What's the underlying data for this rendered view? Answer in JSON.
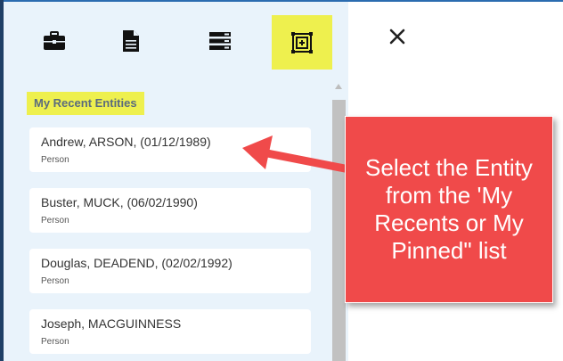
{
  "toolbar": {
    "buttons": [
      {
        "icon": "briefcase-icon",
        "active": false
      },
      {
        "icon": "document-icon",
        "active": false
      },
      {
        "icon": "list-icon",
        "active": false
      },
      {
        "icon": "frame-select-icon",
        "active": true
      }
    ],
    "active_color": "#eef04e"
  },
  "section": {
    "title": "My Recent Entities"
  },
  "entities": [
    {
      "name": "Andrew, ARSON, (01/12/1989)",
      "type": "Person"
    },
    {
      "name": "Buster, MUCK, (06/02/1990)",
      "type": "Person"
    },
    {
      "name": "Douglas, DEADEND, (02/02/1992)",
      "type": "Person"
    },
    {
      "name": "Joseph, MACGUINNESS",
      "type": "Person"
    }
  ],
  "close": {
    "icon": "close-icon"
  },
  "callout": {
    "text": "Select the Entity from the 'My Recents or My Pinned\" list",
    "color": "#f04a4a"
  },
  "colors": {
    "sidebar_bg": "#e9f3fb",
    "border": "#1f3f66"
  }
}
